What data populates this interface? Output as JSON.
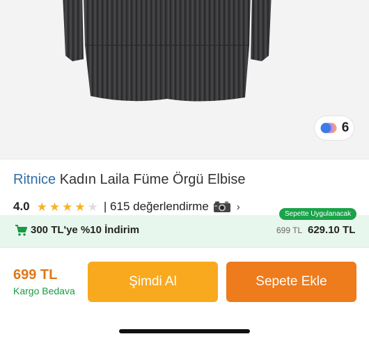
{
  "product": {
    "brand": "Ritnice",
    "name": "Kadın Laila Füme Örgü Elbise",
    "color_count": "6",
    "rating_value": "4.0",
    "rating_stars": 4,
    "rating_max": 5,
    "review_count_text": "| 615 değerlendirme"
  },
  "promotion": {
    "badge": "Sepette Uygulanacak",
    "text": "300 TL'ye %10 İndirim",
    "old_price": "699 TL",
    "new_price": "629.10 TL"
  },
  "purchase": {
    "price": "699 TL",
    "shipping": "Kargo Bedava",
    "buy_now_label": "Şimdi Al",
    "add_to_cart_label": "Sepete Ekle"
  },
  "colors": {
    "brand_link": "#2e6da4",
    "star": "#f5b223",
    "price": "#e07716",
    "shipping": "#1a9a45",
    "promo_bg": "#e8f7ee",
    "buy_button": "#f8a91d",
    "cart_button": "#ee7b1c"
  },
  "icons": [
    "color-variants-icon",
    "star-icon",
    "camera-icon",
    "chevron-right-icon",
    "cart-icon"
  ]
}
